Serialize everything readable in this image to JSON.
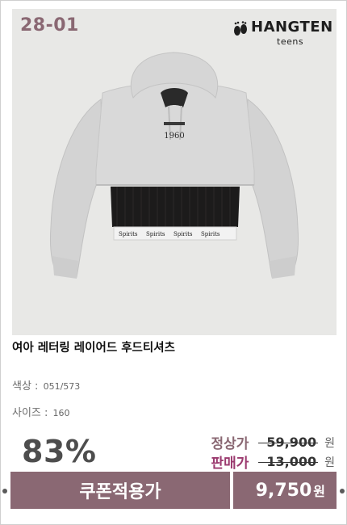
{
  "product_code": "28-01",
  "brand": {
    "name": "HANGTEN",
    "sub": "teens"
  },
  "product": {
    "title": "여아 레터링 레이어드 후드티셔츠",
    "color_label": "색상 :",
    "color_value": "051/573",
    "size_label": "사이즈 :",
    "size_value": "160"
  },
  "print": {
    "hoodie_text": "1960",
    "band_text": "Spirits"
  },
  "pricing": {
    "discount": "83%",
    "regular_label": "정상가",
    "regular_price": "59,900",
    "sale_label": "판매가",
    "sale_price": "13,000",
    "won": "원",
    "coupon_label": "쿠폰적용가",
    "final_price": "9,750",
    "final_won": "원"
  },
  "colors": {
    "accent": "#8a6873",
    "regular_label": "#8a6873",
    "sale_label": "#9b3a6f",
    "strike_text": "#333333"
  }
}
